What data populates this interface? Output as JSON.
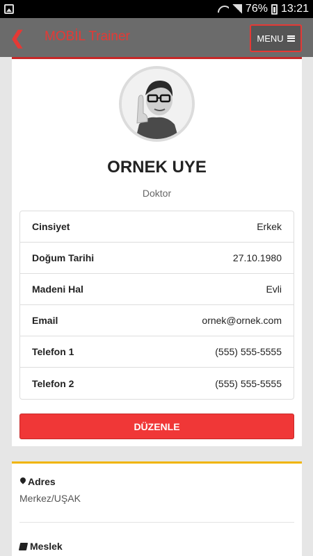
{
  "statusbar": {
    "battery": "76%",
    "time": "13:21"
  },
  "appbar": {
    "title": "MOBİL Trainer",
    "menu_label": "MENU"
  },
  "profile": {
    "name": "ORNEK UYE",
    "job": "Doktor",
    "fields": [
      {
        "label": "Cinsiyet",
        "value": "Erkek"
      },
      {
        "label": "Doğum Tarihi",
        "value": "27.10.1980"
      },
      {
        "label": "Madeni Hal",
        "value": "Evli"
      },
      {
        "label": "Email",
        "value": "ornek@ornek.com"
      },
      {
        "label": "Telefon 1",
        "value": "(555) 555-5555"
      },
      {
        "label": "Telefon 2",
        "value": "(555) 555-5555"
      }
    ],
    "edit_label": "DÜZENLE"
  },
  "details": {
    "address_title": "Adres",
    "address_value": "Merkez/UŞAK",
    "job_title": "Meslek"
  }
}
